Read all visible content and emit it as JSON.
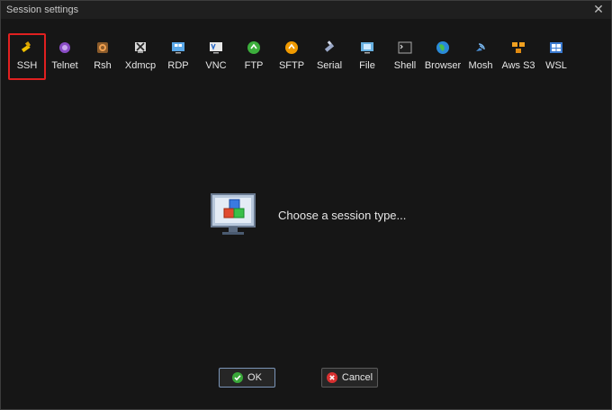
{
  "window": {
    "title": "Session settings",
    "close_glyph": "✕"
  },
  "toolbar": {
    "items": [
      {
        "label": "SSH",
        "icon": "ssh-icon",
        "selected": true
      },
      {
        "label": "Telnet",
        "icon": "telnet-icon"
      },
      {
        "label": "Rsh",
        "icon": "rsh-icon"
      },
      {
        "label": "Xdmcp",
        "icon": "xdmcp-icon"
      },
      {
        "label": "RDP",
        "icon": "rdp-icon"
      },
      {
        "label": "VNC",
        "icon": "vnc-icon"
      },
      {
        "label": "FTP",
        "icon": "ftp-icon"
      },
      {
        "label": "SFTP",
        "icon": "sftp-icon"
      },
      {
        "label": "Serial",
        "icon": "serial-icon"
      },
      {
        "label": "File",
        "icon": "file-icon"
      },
      {
        "label": "Shell",
        "icon": "shell-icon"
      },
      {
        "label": "Browser",
        "icon": "browser-icon"
      },
      {
        "label": "Mosh",
        "icon": "mosh-icon"
      },
      {
        "label": "Aws S3",
        "icon": "aws-s3-icon"
      },
      {
        "label": "WSL",
        "icon": "wsl-icon"
      }
    ]
  },
  "main": {
    "message": "Choose a session type..."
  },
  "buttons": {
    "ok": "OK",
    "cancel": "Cancel"
  },
  "colors": {
    "selection_border": "#e02020",
    "ok_border": "#7b95b8",
    "background": "#161616"
  }
}
